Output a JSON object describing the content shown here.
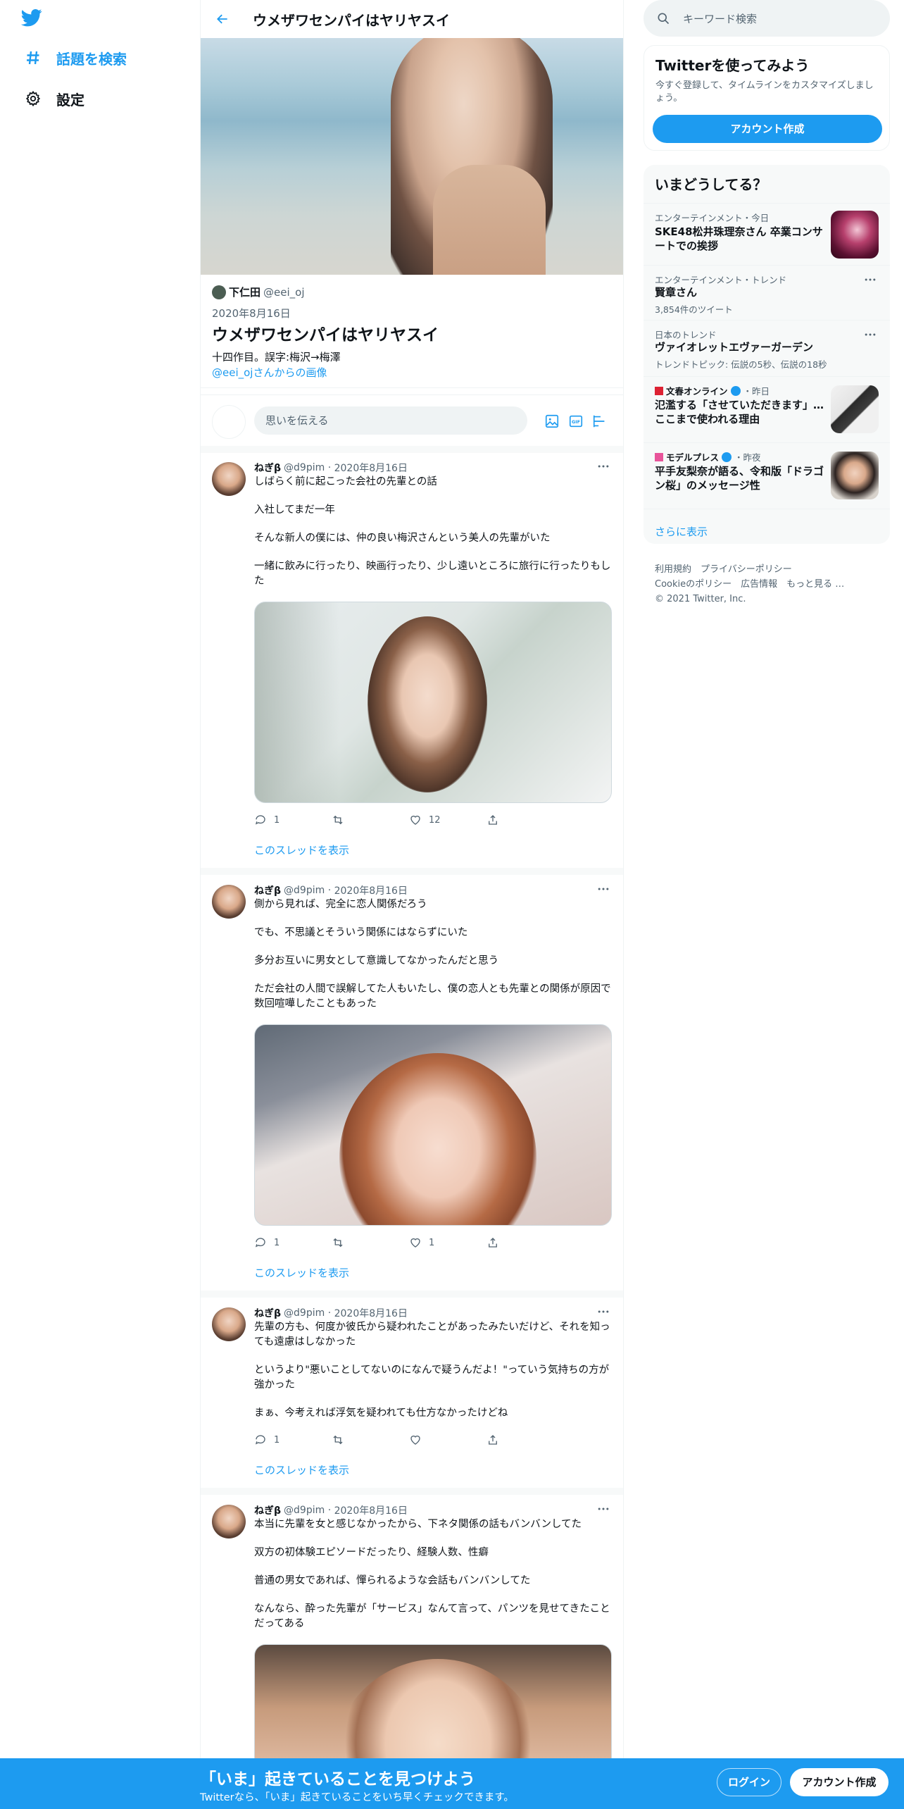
{
  "nav": {
    "logo_icon": "twitter-bird-icon",
    "explore_label": "話題を検索",
    "settings_label": "設定"
  },
  "header": {
    "title": "ウメザワセンパイはヤリヤスイ"
  },
  "list": {
    "owner_name": "下仁田",
    "owner_handle": "@eei_oj",
    "date": "2020年8月16日",
    "title": "ウメザワセンパイはヤリヤスイ",
    "description": "十四作目。誤字:梅沢→梅澤",
    "image_link": "@eei_ojさんからの画像"
  },
  "composer": {
    "placeholder": "思いを伝える"
  },
  "tweets": [
    {
      "name": "ねぎβ",
      "handle": "@d9pim",
      "date": "2020年8月16日",
      "lines": [
        "しばらく前に起こった会社の先輩との話",
        "入社してまだ一年",
        "そんな新人の僕には、仲の良い梅沢さんという美人の先輩がいた",
        "一緒に飲みに行ったり、映画行ったり、少し遠いところに旅行に行ったりもした"
      ],
      "reply_count": "1",
      "retweet_count": "",
      "like_count": "12",
      "thread_label": "このスレッドを表示"
    },
    {
      "name": "ねぎβ",
      "handle": "@d9pim",
      "date": "2020年8月16日",
      "lines": [
        "側から見れば、完全に恋人関係だろう",
        "でも、不思議とそういう関係にはならずにいた",
        "多分お互いに男女として意識してなかったんだと思う",
        "ただ会社の人間で誤解してた人もいたし、僕の恋人とも先輩との関係が原因で数回喧嘩したこともあった"
      ],
      "reply_count": "1",
      "retweet_count": "",
      "like_count": "1",
      "thread_label": "このスレッドを表示"
    },
    {
      "name": "ねぎβ",
      "handle": "@d9pim",
      "date": "2020年8月16日",
      "lines": [
        "先輩の方も、何度か彼氏から疑われたことがあったみたいだけど、それを知っても遠慮はしなかった",
        "というより\"悪いことしてないのになんで疑うんだよ！\"っていう気持ちの方が強かった",
        "まぁ、今考えれば浮気を疑われても仕方なかったけどね"
      ],
      "reply_count": "1",
      "retweet_count": "",
      "like_count": "",
      "thread_label": "このスレッドを表示"
    },
    {
      "name": "ねぎβ",
      "handle": "@d9pim",
      "date": "2020年8月16日",
      "lines": [
        "本当に先輩を女と感じなかったから、下ネタ関係の話もバンバンしてた",
        "双方の初体験エピソードだったり、経験人数、性癖",
        "普通の男女であれば、憚られるような会話もバンバンしてた",
        "なんなら、酔った先輩が「サービス」なんて言って、パンツを見せてきたことだってある"
      ]
    }
  ],
  "sidebar": {
    "search_placeholder": "キーワード検索",
    "signup": {
      "title": "Twitterを使ってみよう",
      "description": "今すぐ登録して、タイムラインをカスタマイズしましょう。",
      "button": "アカウント作成"
    },
    "trends_title": "いまどうしてる？",
    "trends": [
      {
        "context": "エンターテインメント・今日",
        "title": "SKE48松井珠理奈さん 卒業コンサートでの挨拶",
        "count": ""
      },
      {
        "context": "エンターテインメント・トレンド",
        "title": "賢章さん",
        "count": "3,854件のツイート"
      },
      {
        "context": "日本のトレンド",
        "title": "ヴァイオレットエヴァーガーデン",
        "count": "トレンドトピック: 伝説の5秒、伝説の18秒"
      },
      {
        "source": "文春オンライン",
        "time": "・昨日",
        "title": "氾濫する「させていただきます」…ここまで使われる理由"
      },
      {
        "source": "モデルプレス",
        "time": "・昨夜",
        "title": "平手友梨奈が語る、令和版「ドラゴン桜」のメッセージ性"
      }
    ],
    "show_more": "さらに表示",
    "footer_line1": "利用規約　プライバシーポリシー",
    "footer_line2": "Cookieのポリシー　広告情報　もっと見る …",
    "footer_line3": "© 2021 Twitter, Inc."
  },
  "bottombar": {
    "title": "「いま」起きていることを見つけよう",
    "subtitle": "Twitterなら、「いま」起きていることをいち早くチェックできます。",
    "login": "ログイン",
    "create": "アカウント作成"
  },
  "colors": {
    "accent": "#1d9bf0",
    "text": "#0f1419",
    "muted": "#536471"
  }
}
